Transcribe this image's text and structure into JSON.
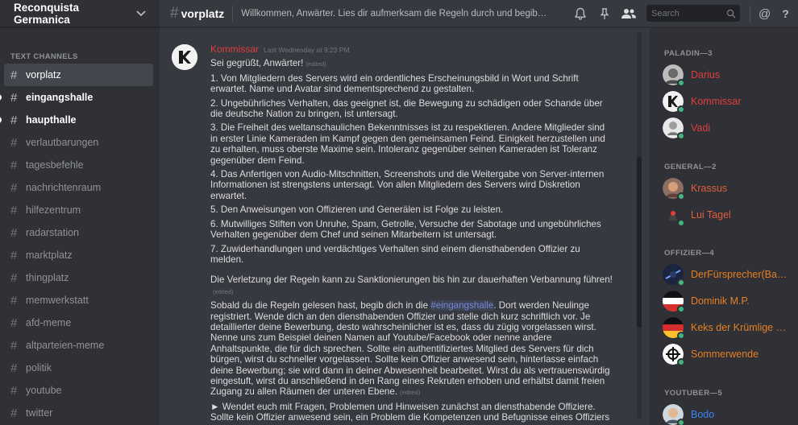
{
  "guild": {
    "name": "Reconquista Germanica"
  },
  "sidebar": {
    "section_label": "TEXT CHANNELS",
    "channels": [
      {
        "name": "vorplatz",
        "state": "active"
      },
      {
        "name": "eingangshalle",
        "state": "unread"
      },
      {
        "name": "haupthalle",
        "state": "unread"
      },
      {
        "name": "verlautbarungen",
        "state": "normal"
      },
      {
        "name": "tagesbefehle",
        "state": "normal"
      },
      {
        "name": "nachrichtenraum",
        "state": "normal"
      },
      {
        "name": "hilfezentrum",
        "state": "normal"
      },
      {
        "name": "radarstation",
        "state": "normal"
      },
      {
        "name": "marktplatz",
        "state": "normal"
      },
      {
        "name": "thingplatz",
        "state": "normal"
      },
      {
        "name": "memwerkstatt",
        "state": "normal"
      },
      {
        "name": "afd-meme",
        "state": "normal"
      },
      {
        "name": "altparteien-meme",
        "state": "normal"
      },
      {
        "name": "politik",
        "state": "normal"
      },
      {
        "name": "youtube",
        "state": "normal"
      },
      {
        "name": "twitter",
        "state": "normal"
      }
    ]
  },
  "topbar": {
    "hash": "#",
    "channel_name": "vorplatz",
    "topic": "Willkommen, Anwärter. Lies dir aufmerksam die Regeln durch und begib…",
    "search_placeholder": "Search",
    "mention_icon": "@",
    "help_icon": "?"
  },
  "message": {
    "author": "Kommissar",
    "author_color": "#e03c3c",
    "timestamp": "Last Wednesday at 9:23 PM",
    "edited_label": "(edited)",
    "greeting": "Sei gegrüßt, Anwärter!",
    "rules": [
      "1. Von Mitgliedern des Servers wird ein ordentliches Erscheinungsbild in Wort und Schrift erwartet. Name und Avatar sind dementsprechend zu gestalten.",
      "2. Ungebührliches Verhalten, das geeignet ist, die Bewegung zu schädigen oder Schande über die deutsche Nation zu bringen, ist untersagt.",
      "3. Die Freiheit des weltanschaulichen Bekenntnisses ist zu respektieren. Andere Mitglieder sind in erster Linie Kameraden im Kampf gegen den gemeinsamen Feind. Einigkeit herzustellen und zu erhalten, muss oberste Maxime sein. Intoleranz gegenüber seinen Kameraden ist Toleranz gegenüber dem Feind.",
      "4. Das Anfertigen von Audio-Mitschnitten, Screenshots und die Weitergabe von Server-internen Informationen ist strengstens untersagt. Von allen Mitgliedern des Servers wird Diskretion erwartet.",
      "5. Den Anweisungen von Offizieren und Generälen ist Folge zu leisten.",
      "6. Mutwilliges Stiften von Unruhe, Spam, Getrolle, Versuche der Sabotage und ungebührliches Verhalten gegenüber dem Chef und seinen Mitarbeitern ist untersagt.",
      "7. Zuwiderhandlungen und verdächtiges Verhalten sind einem diensthabenden Offizier zu melden."
    ],
    "warning": "Die Verletzung der Regeln kann zu Sanktionierungen bis hin zur dauerhaften Verbannung führen!",
    "instructions_before": "Sobald du die Regeln gelesen hast, begib dich in die ",
    "instructions_mention": "#eingangshalle",
    "instructions_after": ". Dort werden Neulinge registriert. Wende dich an den diensthabenden Offizier und stelle dich kurz schriftlich vor. Je detaillierter deine Bewerbung, desto wahrscheinlicher ist es, dass du zügig vorgelassen wirst. Nenne uns zum Beispiel deinen Namen auf Youtube/Facebook oder nenne andere Anhaltspunkte, die für dich sprechen. Sollte ein authentifiziertes Mitglied des Servers für dich bürgen, wirst du schneller vorgelassen. Sollte kein Offizier anwesend sein, hinterlasse einfach deine Bewerbung; sie wird dann in deiner Abwesenheit bearbeitet. Wirst du als vertrauenswürdig eingestuft, wirst du anschließend in den Rang eines Rekruten erhoben und erhältst damit freien Zugang zu allen Räumen der unteren Ebene.",
    "final_line_1": "► Wendet euch mit Fragen, Problemen und Hinweisen zunächst an diensthabende Offiziere.",
    "final_line_2": "Sollte kein Offizier anwesend sein, ein Problem die Kompetenzen und Befugnisse eines Offiziers"
  },
  "members": {
    "groups": [
      {
        "label": "PALADIN—3",
        "members": [
          {
            "name": "Darius",
            "color": "#e03c3c",
            "avatar": "darius"
          },
          {
            "name": "Kommissar",
            "color": "#e03c3c",
            "avatar": "kommissar"
          },
          {
            "name": "Vadi",
            "color": "#e03c3c",
            "avatar": "vadi"
          }
        ]
      },
      {
        "label": "GENERAL—2",
        "members": [
          {
            "name": "Krassus",
            "color": "#e05e3c",
            "avatar": "krassus"
          },
          {
            "name": "Lui Tagel",
            "color": "#e05e3c",
            "avatar": "lui"
          }
        ]
      },
      {
        "label": "OFFIZIER—4",
        "members": [
          {
            "name": "DerFürsprecher(Ba…",
            "color": "#e67e22",
            "avatar": "fuersprecher"
          },
          {
            "name": "Dominik M.P.",
            "color": "#e67e22",
            "avatar": "dominik"
          },
          {
            "name": "Keks der Krümlige …",
            "color": "#e67e22",
            "avatar": "keks"
          },
          {
            "name": "Sommerwende",
            "color": "#e67e22",
            "avatar": "sommerwende"
          }
        ]
      },
      {
        "label": "YOUTUBER—5",
        "members": [
          {
            "name": "Bodo",
            "color": "#3b82f6",
            "avatar": "bodo"
          }
        ]
      }
    ]
  },
  "colors": {
    "accent": "#7289da",
    "online": "#43b581"
  }
}
